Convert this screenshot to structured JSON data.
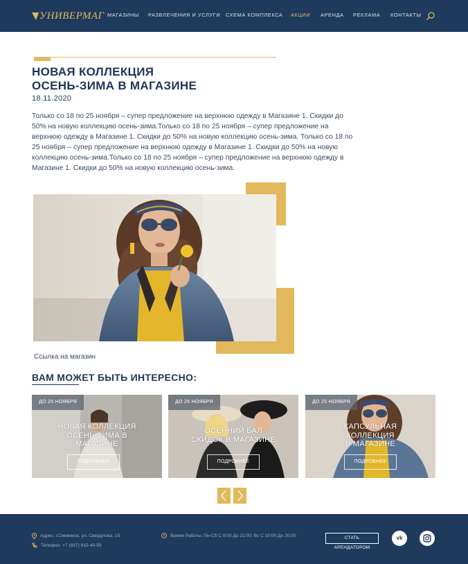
{
  "header": {
    "logo_text": "УНИВЕРМАГ",
    "nav": [
      {
        "label": "МАГАЗИНЫ",
        "active": false
      },
      {
        "label": "РАЗВЛЕЧЕНИЯ И УСЛУГИ",
        "active": false
      },
      {
        "label": "СХЕМА КОМПЛЕКСА",
        "active": false
      },
      {
        "label": "АКЦИИ",
        "active": true
      },
      {
        "label": "АРЕНДА",
        "active": false
      },
      {
        "label": "РЕКЛАМА",
        "active": false
      },
      {
        "label": "КОНТАКТЫ",
        "active": false
      }
    ],
    "search_icon": "search-icon"
  },
  "article": {
    "title_line1": "НОВАЯ КОЛЛЕКЦИЯ",
    "title_line2": "ОСЕНЬ-ЗИМА В МАГАЗИНЕ",
    "date": "18.11.2020",
    "body": "Только со 18  по 25 ноября – супер предложение на верхнюю одежду в  Магазине 1. Скидки до 50% на новую коллекцию осень-зима.Только со 18  по 25 ноября – супер предложение на верхнюю одежду в  Магазине 1. Скидки до 50% на новую коллекцию осень-зима. Только со 18  по 25 ноября – супер предложение на верхнюю одежду в Магазине 1. Скидки до 50% на новую коллекцию осень-зима.Только со 18  по 25 ноября – супер предложение на верхнюю одежду в  Магазине 1. Скидки до 50% на новую коллекцию осень-зима.",
    "link_label": "Ссылка на магазин"
  },
  "related": {
    "heading": "ВАМ МОЖЕТ БЫТЬ ИНТЕРЕСНО:",
    "cards": [
      {
        "badge": "ДО 25 НОЯБРЯ",
        "title_lines": [
          "НОВАЯ КОЛЛЕКЦИЯ",
          "ОСЕНЬ-ЗИМА В",
          "МАГАЗИНЕ"
        ],
        "button": "ПОДРОБНЕЕ"
      },
      {
        "badge": "ДО 25 НОЯБРЯ",
        "title_lines": [
          "ОСЕННИЙ БАЛ",
          "СКИДОК В МАГАЗИНЕ"
        ],
        "button": "ПОДРОБНЕЕ"
      },
      {
        "badge": "ДО 25 НОЯБРЯ",
        "title_lines": [
          "КАПСУЛЬНАЯ",
          "КОЛЛЕКЦИЯ",
          "В МАГАЗИНЕ"
        ],
        "button": "ПОДРОБНЕЕ"
      }
    ],
    "prev_icon": "chevron-left-icon",
    "next_icon": "chevron-right-icon"
  },
  "footer": {
    "address": "Адрес: г.Снежинск, ул. Свердлова, 15",
    "phone": "Телефон: +7 (937) 915-40-59",
    "hours": "Время Работы: Пн-Сб С 9:00 До 21:00;  Вс  С 10:00 До 20:00",
    "tenant_button": "СТАТЬ АРЕНДАТОРОМ",
    "social": [
      {
        "name": "vk-icon",
        "label": "vk"
      },
      {
        "name": "instagram-icon",
        "label": ""
      }
    ]
  },
  "colors": {
    "navy": "#1e3a5c",
    "gold": "#e2b85c",
    "text": "#1e3556"
  }
}
